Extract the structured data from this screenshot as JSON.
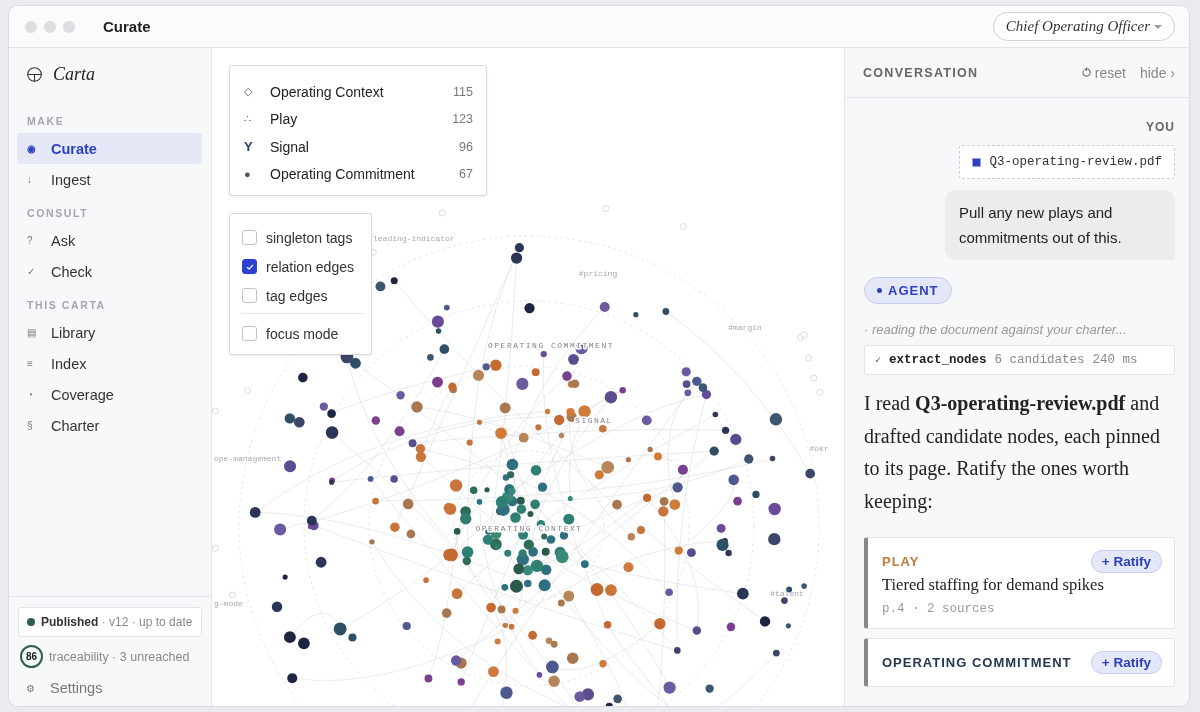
{
  "window": {
    "title": "Curate",
    "role_select": "Chief Operating Officer"
  },
  "sidebar": {
    "brand": "Carta",
    "sections": [
      {
        "heading": "MAKE",
        "items": [
          {
            "icon": "◉",
            "label": "Curate",
            "selected": true
          },
          {
            "icon": "↓",
            "label": "Ingest",
            "selected": false
          }
        ]
      },
      {
        "heading": "CONSULT",
        "items": [
          {
            "icon": "?",
            "label": "Ask",
            "selected": false
          },
          {
            "icon": "✓",
            "label": "Check",
            "selected": false
          }
        ]
      },
      {
        "heading": "THIS CARTA",
        "items": [
          {
            "icon": "▤",
            "label": "Library",
            "selected": false
          },
          {
            "icon": "≡",
            "label": "Index",
            "selected": false
          },
          {
            "icon": "◔",
            "label": "Coverage",
            "selected": false
          },
          {
            "icon": "§",
            "label": "Charter",
            "selected": false
          }
        ]
      }
    ],
    "status": {
      "state": "Published",
      "meta": "· v12 · up to date",
      "color": "#2d5e48"
    },
    "traceability": {
      "score": "86",
      "text": "traceability · 3 unreached"
    },
    "settings": {
      "icon": "⚙",
      "label": "Settings"
    }
  },
  "legend": [
    {
      "glyph": "◇",
      "label": "Operating Context",
      "count": "115"
    },
    {
      "glyph": "∴",
      "label": "Play",
      "count": "123"
    },
    {
      "glyph": "Y",
      "label": "Signal",
      "count": "96"
    },
    {
      "glyph": "●",
      "label": "Operating Commitment",
      "count": "67"
    }
  ],
  "toggles": [
    {
      "label": "singleton tags",
      "checked": false
    },
    {
      "label": "relation edges",
      "checked": true
    },
    {
      "label": "tag edges",
      "checked": false
    }
  ],
  "mode_toggles": [
    {
      "label": "focus mode",
      "checked": false
    }
  ],
  "graph": {
    "ring_labels": [
      "OPERATING COMMITMENT",
      "SIGNAL",
      "OPERATING CONTEXT"
    ],
    "tag_labels": [
      "leading-indicator",
      "#pricing",
      "#margin",
      "#okr",
      "#talent",
      "ope-management",
      "g-mode"
    ]
  },
  "conversation": {
    "title": "CONVERSATION",
    "reset": "reset",
    "hide": "hide ›",
    "you_label": "YOU",
    "attachment": "Q3-operating-review.pdf",
    "user_message": "Pull any new plays and commitments out of this.",
    "agent_label": "AGENT",
    "agent_status": "· reading the document against your charter...",
    "tool": {
      "icon": "✓",
      "name": "extract_nodes",
      "result": "6 candidates",
      "time": "240 ms"
    },
    "reply": "I read **Q3-operating-review.pdf** and drafted candidate nodes, each pinned to its page. Ratify the ones worth keeping:",
    "candidates": [
      {
        "type": "PLAY",
        "color": "#c07a3a",
        "title": "Tiered staffing for demand spikes",
        "meta": "p.4 · 2 sources",
        "action": "+ Ratify"
      },
      {
        "type": "OPERATING COMMITMENT",
        "color": "#24384f",
        "action": "+ Ratify"
      }
    ]
  }
}
